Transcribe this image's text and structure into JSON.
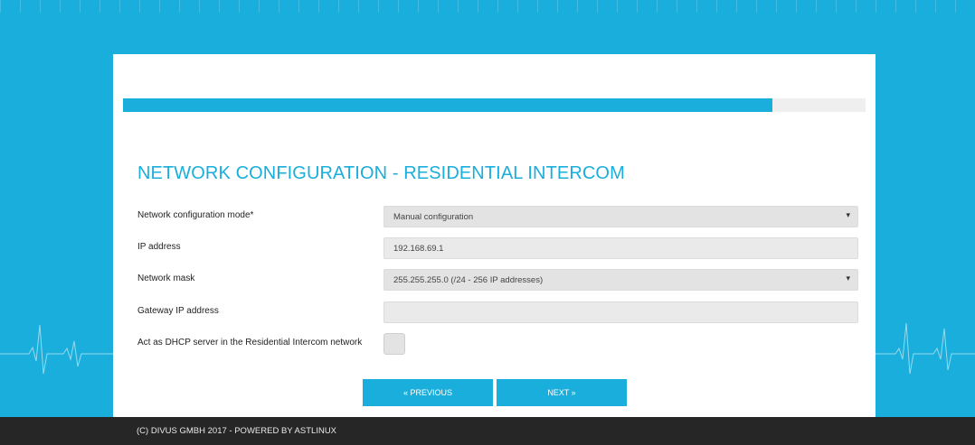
{
  "page": {
    "title": "NETWORK CONFIGURATION - RESIDENTIAL INTERCOM",
    "progress_percent": 87.5
  },
  "form": {
    "mode": {
      "label": "Network configuration mode*",
      "value": "Manual configuration"
    },
    "ip": {
      "label": "IP address",
      "value": "192.168.69.1"
    },
    "mask": {
      "label": "Network mask",
      "value": "255.255.255.0 (/24 - 256 IP addresses)"
    },
    "gateway": {
      "label": "Gateway IP address",
      "value": ""
    },
    "dhcp": {
      "label": "Act as DHCP server in the Residential Intercom network",
      "checked": false
    }
  },
  "buttons": {
    "previous": "« PREVIOUS",
    "next": "NEXT »"
  },
  "footer": {
    "text": "(C) DIVUS GMBH 2017 - POWERED BY ASTLINUX"
  },
  "icons": {
    "dropdown": "chevron-down-icon",
    "background_decoration": "ecg-heartbeat-icon"
  },
  "colors": {
    "accent": "#1aaedc",
    "footer": "#262626",
    "field_bg": "#eaeaea",
    "progress_track": "#efefef"
  }
}
